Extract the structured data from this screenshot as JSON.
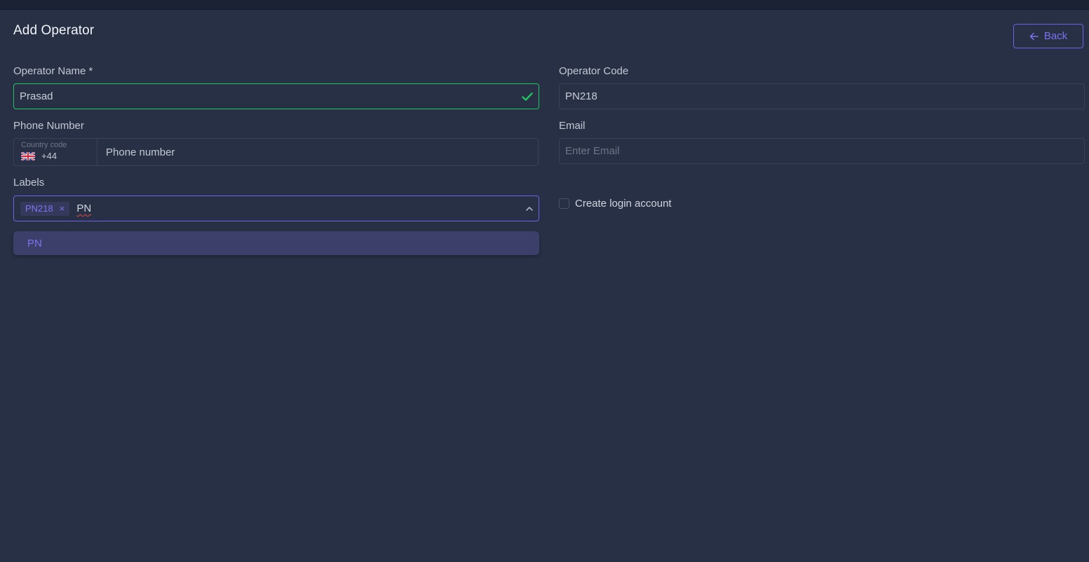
{
  "page": {
    "title": "Add Operator",
    "back_label": "Back"
  },
  "form": {
    "operator_name": {
      "label": "Operator Name *",
      "value": "Prasad",
      "status": "valid"
    },
    "operator_code": {
      "label": "Operator Code",
      "value": "PN218"
    },
    "phone": {
      "label": "Phone Number",
      "country_code_label": "Country code",
      "country_flag": "uk-flag-icon",
      "country_code": "+44",
      "placeholder": "Phone number"
    },
    "email": {
      "label": "Email",
      "placeholder": "Enter Email"
    },
    "labels": {
      "label": "Labels",
      "tags": [
        "PN218"
      ],
      "query": "PN",
      "options": [
        "PN"
      ]
    },
    "create_login": {
      "label": "Create login account",
      "checked": false
    }
  },
  "colors": {
    "background": "#273044",
    "accent": "#6c63e6",
    "valid": "#22c55e",
    "border": "#3a4257"
  }
}
